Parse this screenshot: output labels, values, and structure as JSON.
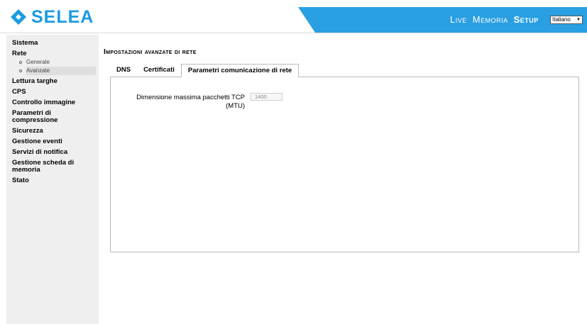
{
  "header": {
    "logo_text": "SELEA",
    "nav": [
      {
        "label": "Live",
        "active": false
      },
      {
        "label": "Memoria",
        "active": false
      },
      {
        "label": "Setup",
        "active": true
      }
    ],
    "language_selected": "Italiano",
    "accent_color": "#1b9be0"
  },
  "sidebar": {
    "items": [
      {
        "label": "Sistema"
      },
      {
        "label": "Rete"
      },
      {
        "label": "Generale"
      },
      {
        "label": "Avanzate"
      },
      {
        "label": "Lettura targhe"
      },
      {
        "label": "CPS"
      },
      {
        "label": "Controllo immagine"
      },
      {
        "label": "Parametri di compressione"
      },
      {
        "label": "Sicurezza"
      },
      {
        "label": "Gestione eventi"
      },
      {
        "label": "Servizi di notifica"
      },
      {
        "label": "Gestione scheda di memoria"
      },
      {
        "label": "Stato"
      }
    ]
  },
  "main": {
    "title": "Impostazioni avanzate di rete",
    "tabs": [
      {
        "label": "DNS"
      },
      {
        "label": "Certificati"
      },
      {
        "label": "Parametri comunicazione di rete"
      }
    ],
    "active_tab": "Parametri comunicazione di rete",
    "mtu": {
      "label": "Dimensione massima pacchetti TCP (MTU)",
      "value": "1400"
    }
  }
}
